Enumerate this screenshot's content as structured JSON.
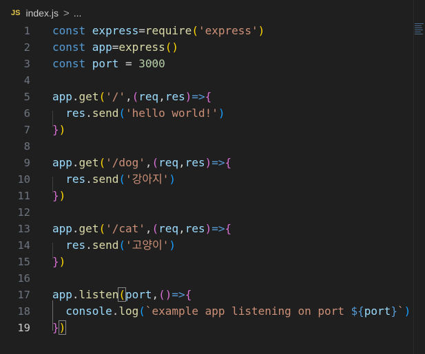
{
  "breadcrumb": {
    "lang_badge": "JS",
    "file": "index.js",
    "separator": ">",
    "more": "..."
  },
  "hover_dots": "...",
  "editor": {
    "active_line": 19,
    "lines": [
      {
        "n": "1",
        "tokens": [
          {
            "t": "const ",
            "c": "kw"
          },
          {
            "t": "express",
            "c": "var"
          },
          {
            "t": "=",
            "c": "op"
          },
          {
            "t": "require",
            "c": "fn"
          },
          {
            "t": "(",
            "c": "p0"
          },
          {
            "t": "'express'",
            "c": "str"
          },
          {
            "t": ")",
            "c": "p0"
          }
        ]
      },
      {
        "n": "2",
        "tokens": [
          {
            "t": "const ",
            "c": "kw"
          },
          {
            "t": "app",
            "c": "var"
          },
          {
            "t": "=",
            "c": "op"
          },
          {
            "t": "express",
            "c": "fn"
          },
          {
            "t": "()",
            "c": "p0"
          }
        ]
      },
      {
        "n": "3",
        "tokens": [
          {
            "t": "const ",
            "c": "kw"
          },
          {
            "t": "port",
            "c": "var"
          },
          {
            "t": " = ",
            "c": "op"
          },
          {
            "t": "3000",
            "c": "num"
          }
        ]
      },
      {
        "n": "4",
        "tokens": []
      },
      {
        "n": "5",
        "tokens": [
          {
            "t": "app",
            "c": "var"
          },
          {
            "t": ".",
            "c": "op"
          },
          {
            "t": "get",
            "c": "fn"
          },
          {
            "t": "(",
            "c": "p0"
          },
          {
            "t": "'/'",
            "c": "str"
          },
          {
            "t": ",",
            "c": "op"
          },
          {
            "t": "(",
            "c": "p1"
          },
          {
            "t": "req",
            "c": "var"
          },
          {
            "t": ",",
            "c": "op"
          },
          {
            "t": "res",
            "c": "var"
          },
          {
            "t": ")",
            "c": "p1"
          },
          {
            "t": "=>",
            "c": "kw"
          },
          {
            "t": "{",
            "c": "p1"
          }
        ]
      },
      {
        "n": "6",
        "tokens": [
          {
            "t": "  res",
            "c": "var"
          },
          {
            "t": ".",
            "c": "op"
          },
          {
            "t": "send",
            "c": "fn"
          },
          {
            "t": "(",
            "c": "p2"
          },
          {
            "t": "'hello world!'",
            "c": "str"
          },
          {
            "t": ")",
            "c": "p2"
          }
        ]
      },
      {
        "n": "7",
        "tokens": [
          {
            "t": "}",
            "c": "p1"
          },
          {
            "t": ")",
            "c": "p0"
          }
        ]
      },
      {
        "n": "8",
        "tokens": []
      },
      {
        "n": "9",
        "tokens": [
          {
            "t": "app",
            "c": "var"
          },
          {
            "t": ".",
            "c": "op"
          },
          {
            "t": "get",
            "c": "fn"
          },
          {
            "t": "(",
            "c": "p0"
          },
          {
            "t": "'/dog'",
            "c": "str"
          },
          {
            "t": ",",
            "c": "op"
          },
          {
            "t": "(",
            "c": "p1"
          },
          {
            "t": "req",
            "c": "var"
          },
          {
            "t": ",",
            "c": "op"
          },
          {
            "t": "res",
            "c": "var"
          },
          {
            "t": ")",
            "c": "p1"
          },
          {
            "t": "=>",
            "c": "kw"
          },
          {
            "t": "{",
            "c": "p1"
          }
        ]
      },
      {
        "n": "10",
        "tokens": [
          {
            "t": "  res",
            "c": "var"
          },
          {
            "t": ".",
            "c": "op"
          },
          {
            "t": "send",
            "c": "fn"
          },
          {
            "t": "(",
            "c": "p2"
          },
          {
            "t": "'강아지'",
            "c": "str"
          },
          {
            "t": ")",
            "c": "p2"
          }
        ]
      },
      {
        "n": "11",
        "tokens": [
          {
            "t": "}",
            "c": "p1"
          },
          {
            "t": ")",
            "c": "p0"
          }
        ]
      },
      {
        "n": "12",
        "tokens": []
      },
      {
        "n": "13",
        "tokens": [
          {
            "t": "app",
            "c": "var"
          },
          {
            "t": ".",
            "c": "op"
          },
          {
            "t": "get",
            "c": "fn"
          },
          {
            "t": "(",
            "c": "p0"
          },
          {
            "t": "'/cat'",
            "c": "str"
          },
          {
            "t": ",",
            "c": "op"
          },
          {
            "t": "(",
            "c": "p1"
          },
          {
            "t": "req",
            "c": "var"
          },
          {
            "t": ",",
            "c": "op"
          },
          {
            "t": "res",
            "c": "var"
          },
          {
            "t": ")",
            "c": "p1"
          },
          {
            "t": "=>",
            "c": "kw"
          },
          {
            "t": "{",
            "c": "p1"
          }
        ]
      },
      {
        "n": "14",
        "tokens": [
          {
            "t": "  res",
            "c": "var"
          },
          {
            "t": ".",
            "c": "op"
          },
          {
            "t": "send",
            "c": "fn"
          },
          {
            "t": "(",
            "c": "p2"
          },
          {
            "t": "'고양이'",
            "c": "str"
          },
          {
            "t": ")",
            "c": "p2"
          }
        ]
      },
      {
        "n": "15",
        "tokens": [
          {
            "t": "}",
            "c": "p1"
          },
          {
            "t": ")",
            "c": "p0"
          }
        ]
      },
      {
        "n": "16",
        "tokens": []
      },
      {
        "n": "17",
        "tokens": [
          {
            "t": "app",
            "c": "var"
          },
          {
            "t": ".",
            "c": "op"
          },
          {
            "t": "listen",
            "c": "fn"
          },
          {
            "t": "(",
            "c": "p0",
            "m": true
          },
          {
            "t": "port",
            "c": "var"
          },
          {
            "t": ",",
            "c": "op"
          },
          {
            "t": "()",
            "c": "p1"
          },
          {
            "t": "=>",
            "c": "kw"
          },
          {
            "t": "{",
            "c": "p1"
          }
        ]
      },
      {
        "n": "18",
        "tokens": [
          {
            "t": "  console",
            "c": "var"
          },
          {
            "t": ".",
            "c": "op"
          },
          {
            "t": "log",
            "c": "fn"
          },
          {
            "t": "(",
            "c": "p2"
          },
          {
            "t": "`example app listening on port ",
            "c": "str"
          },
          {
            "t": "${",
            "c": "kw"
          },
          {
            "t": "port",
            "c": "var"
          },
          {
            "t": "}",
            "c": "kw"
          },
          {
            "t": "`",
            "c": "str"
          },
          {
            "t": ")",
            "c": "p2"
          }
        ]
      },
      {
        "n": "19",
        "tokens": [
          {
            "t": "}",
            "c": "p1"
          },
          {
            "t": ")",
            "c": "p0",
            "m": true
          }
        ]
      }
    ]
  }
}
